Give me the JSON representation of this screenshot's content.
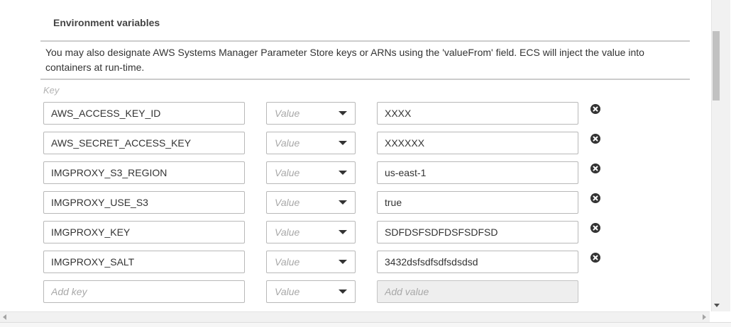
{
  "section": {
    "title": "Environment variables",
    "description": "You may also designate AWS Systems Manager Parameter Store keys or ARNs using the 'valueFrom' field. ECS will inject the value into containers at run-time."
  },
  "table": {
    "key_header": "Key",
    "rows": [
      {
        "key": "AWS_ACCESS_KEY_ID",
        "type": "Value",
        "value": "XXXX"
      },
      {
        "key": "AWS_SECRET_ACCESS_KEY",
        "type": "Value",
        "value": "XXXXXX"
      },
      {
        "key": "IMGPROXY_S3_REGION",
        "type": "Value",
        "value": "us-east-1"
      },
      {
        "key": "IMGPROXY_USE_S3",
        "type": "Value",
        "value": "true"
      },
      {
        "key": "IMGPROXY_KEY",
        "type": "Value",
        "value": "SDFDSFSDFDSFSDFSD"
      },
      {
        "key": "IMGPROXY_SALT",
        "type": "Value",
        "value": "3432dsfsdfsdfsdsdsd"
      }
    ],
    "new_row": {
      "key_placeholder": "Add key",
      "type": "Value",
      "value_placeholder": "Add value"
    }
  },
  "icons": {
    "remove": "remove-circle-x-icon",
    "dropdown": "caret-down-icon"
  },
  "colors": {
    "input_border": "#b8b8b8",
    "placeholder": "#a8a8a8",
    "disabled_bg": "#eeeeee",
    "remove_icon": "#333333"
  }
}
